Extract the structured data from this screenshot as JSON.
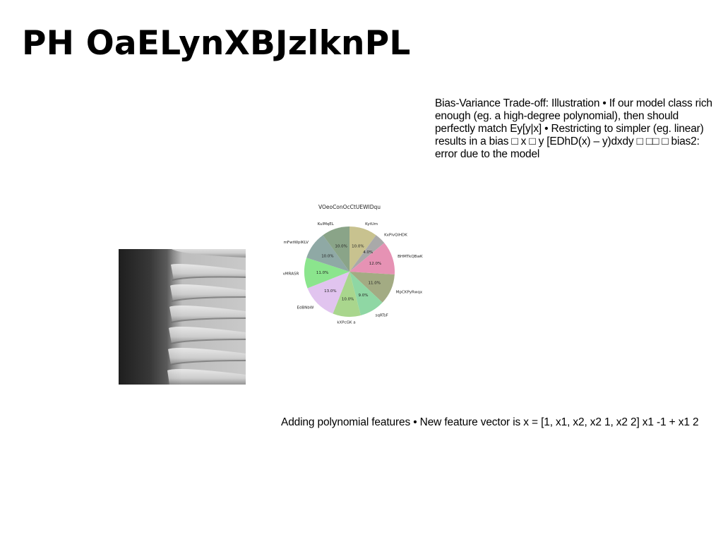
{
  "slide": {
    "title": "PH OaELynXBJzlknPL",
    "bias_paragraph": "Bias-Variance Trade-off: Illustration • If our model class rich enough (eg. a high-degree polynomial), then should perfectly match Ey[y|x] • Restricting to simpler (eg. linear) results in a bias □ x □ y [EDhD(x) – y)dxdy □ □□ □ bias2: error due to the model",
    "poly_paragraph": "Adding polynomial features • New feature vector is x = [1, x1, x2, x2 1, x2 2] x1 -1 + x1 2",
    "photo_icon": "grayscale-photo"
  },
  "chart_data": {
    "type": "pie",
    "title": "VOeoConOcCtUEWIDqu",
    "categories": [
      "KytUm",
      "KxPlvQiHDK",
      "BHMTkQBwK",
      "MpCKPyRwqx",
      "sqRTsF",
      "kXPcGK a",
      "EdBNbW",
      "vMRASR",
      "mFwtWpIKLV",
      "KuIMqEL"
    ],
    "values": [
      10.0,
      4.0,
      12.0,
      11.0,
      9.0,
      10.0,
      13.0,
      11.0,
      10.0,
      10.0
    ],
    "labels": [
      "10.0%",
      "4.0%",
      "12.0%",
      "11.0%",
      "9.0%",
      "10.0%",
      "13.0%",
      "11.0%",
      "10.0%",
      "10.0%"
    ],
    "colors": [
      "#c8c28f",
      "#a9a9a9",
      "#e692b4",
      "#a3ab83",
      "#8fd7a4",
      "#a9d68d",
      "#e1c4ef",
      "#8be58d",
      "#8fa9a5",
      "#8aa488"
    ],
    "start_angle_deg": 90,
    "direction": "clockwise",
    "legend": "none"
  }
}
